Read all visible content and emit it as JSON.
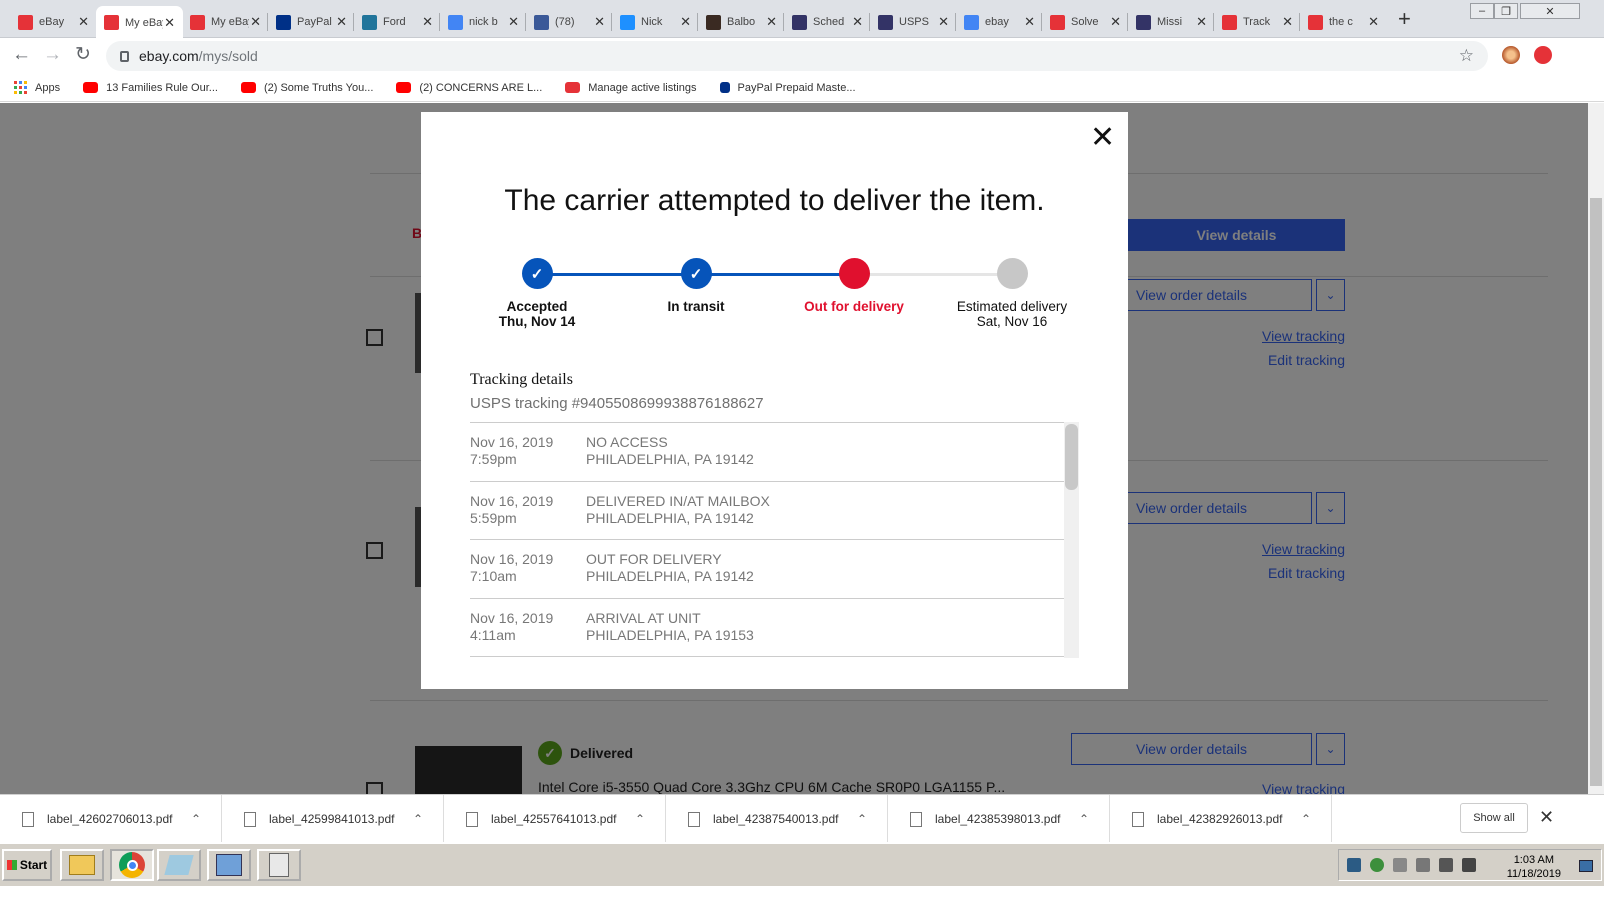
{
  "browser": {
    "tabs": [
      {
        "label": "eBay",
        "icon": "ebay-bag-icon",
        "color": "#e53238"
      },
      {
        "label": "My eBay",
        "icon": "ebay-bag-icon",
        "color": "#e53238"
      },
      {
        "label": "My eBay",
        "icon": "ebay-bag-icon",
        "color": "#e53238"
      },
      {
        "label": "PayPal",
        "icon": "paypal-icon",
        "color": "#003087"
      },
      {
        "label": "Ford",
        "icon": "wordpress-icon",
        "color": "#21759b"
      },
      {
        "label": "nick b",
        "icon": "google-icon",
        "color": "#4285f4"
      },
      {
        "label": "(78)",
        "icon": "facebook-icon",
        "color": "#3b5998"
      },
      {
        "label": "Nick",
        "icon": "app-icon",
        "color": "#1e90ff"
      },
      {
        "label": "Balbo",
        "icon": "ba-icon",
        "color": "#3a2a22"
      },
      {
        "label": "Sched",
        "icon": "usps-icon",
        "color": "#333366"
      },
      {
        "label": "USPS",
        "icon": "usps-icon",
        "color": "#333366"
      },
      {
        "label": "ebay",
        "icon": "google-icon",
        "color": "#4285f4"
      },
      {
        "label": "Solve",
        "icon": "ebay-bag-icon",
        "color": "#e53238"
      },
      {
        "label": "Missi",
        "icon": "usps-icon",
        "color": "#333366"
      },
      {
        "label": "Track",
        "icon": "ebay-bag-icon",
        "color": "#e53238"
      },
      {
        "label": "the c",
        "icon": "ebay-bag-icon",
        "color": "#e53238"
      }
    ],
    "url_host": "ebay.com",
    "url_path": "/mys/sold",
    "bookmarks": [
      {
        "label": "Apps",
        "icon": "apps-grid-icon"
      },
      {
        "label": "13 Families Rule Our...",
        "icon": "youtube-icon"
      },
      {
        "label": "(2) Some Truths You...",
        "icon": "youtube-icon"
      },
      {
        "label": "(2) CONCERNS ARE L...",
        "icon": "youtube-icon"
      },
      {
        "label": "Manage active listings",
        "icon": "ebay-bag-icon"
      },
      {
        "label": "PayPal Prepaid Maste...",
        "icon": "paypal-icon"
      }
    ]
  },
  "page": {
    "red_partial": "B",
    "view_details": "View details",
    "view_order_details": "View order details",
    "view_tracking": "View tracking",
    "edit_tracking": "Edit tracking",
    "delivered_status": "Delivered",
    "item_title": "Intel Core i5-3550 Quad Core 3.3Ghz CPU 6M Cache SR0P0 LGA1155 P..."
  },
  "modal": {
    "title": "The carrier attempted to deliver the item.",
    "steps": [
      {
        "label": "Accepted",
        "date": "Thu, Nov 14",
        "state": "done"
      },
      {
        "label": "In transit",
        "date": "",
        "state": "done"
      },
      {
        "label": "Out for delivery",
        "date": "",
        "state": "current"
      },
      {
        "label": "Estimated delivery",
        "date": "Sat, Nov 16",
        "state": "pending"
      }
    ],
    "details_title": "Tracking details",
    "tracking_number": "USPS tracking #9405508699938876188627",
    "events": [
      {
        "date": "Nov 16, 2019",
        "time": "7:59pm",
        "status": "NO ACCESS",
        "location": "PHILADELPHIA, PA 19142"
      },
      {
        "date": "Nov 16, 2019",
        "time": "5:59pm",
        "status": "DELIVERED IN/AT MAILBOX",
        "location": "PHILADELPHIA, PA 19142"
      },
      {
        "date": "Nov 16, 2019",
        "time": "7:10am",
        "status": "OUT FOR DELIVERY",
        "location": "PHILADELPHIA, PA 19142"
      },
      {
        "date": "Nov 16, 2019",
        "time": "4:11am",
        "status": "ARRIVAL AT UNIT",
        "location": "PHILADELPHIA, PA 19153"
      }
    ],
    "colors": {
      "done": "#0654ba",
      "current": "#e0102e",
      "pending": "#c7c7c7"
    }
  },
  "downloads": {
    "files": [
      "label_42602706013.pdf",
      "label_42599841013.pdf",
      "label_42557641013.pdf",
      "label_42387540013.pdf",
      "label_42385398013.pdf",
      "label_42382926013.pdf"
    ],
    "show_all": "Show all"
  },
  "taskbar": {
    "start_label": "Start",
    "time": "1:03 AM",
    "date": "11/18/2019"
  }
}
